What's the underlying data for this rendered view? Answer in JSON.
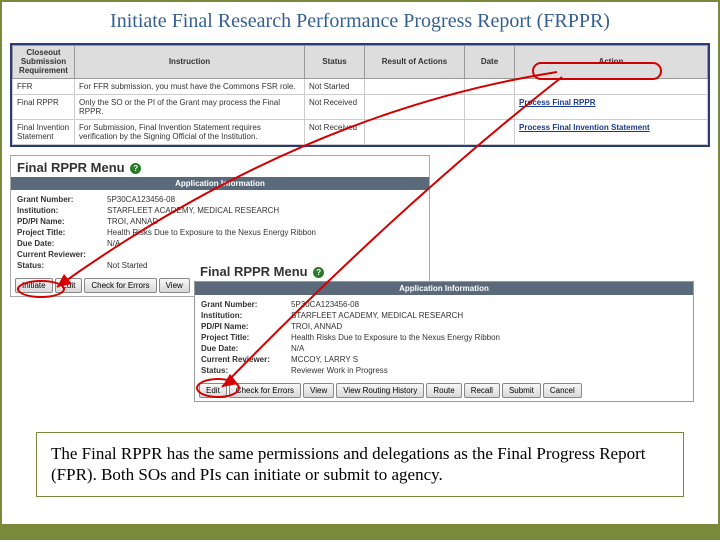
{
  "title": "Initiate Final Research Performance Progress Report (FRPPR)",
  "table": {
    "headers": [
      "Closeout Submission Requirement",
      "Instruction",
      "Status",
      "Result of Actions",
      "Date",
      "Action"
    ],
    "rows": [
      {
        "req": "FFR",
        "inst": "For FFR submission, you must have the Commons FSR role.",
        "status": "Not Started",
        "result": "",
        "date": "",
        "action": ""
      },
      {
        "req": "Final RPPR",
        "inst": "Only the SO or the PI of the Grant may process the Final RPPR.",
        "status": "Not Received",
        "result": "",
        "date": "",
        "action": "Process Final RPPR"
      },
      {
        "req": "Final Invention Statement",
        "inst": "For Submission, Final Invention Statement requires verification by the Signing Official of the Institution.",
        "status": "Not Received",
        "result": "",
        "date": "",
        "action": "Process Final Invention Statement"
      }
    ]
  },
  "panel_title": "Final RPPR Menu",
  "app_info_label": "Application Information",
  "panel1_info": [
    {
      "label": "Grant Number:",
      "value": "5P30CA123456-08"
    },
    {
      "label": "Institution:",
      "value": "STARFLEET ACADEMY, MEDICAL RESEARCH"
    },
    {
      "label": "PD/PI Name:",
      "value": "TROI, ANNAD"
    },
    {
      "label": "Project Title:",
      "value": "Health Risks Due to Exposure to the Nexus Energy Ribbon"
    },
    {
      "label": "Due Date:",
      "value": "N/A"
    },
    {
      "label": "Current Reviewer:",
      "value": ""
    },
    {
      "label": "Status:",
      "value": "Not Started"
    }
  ],
  "panel1_buttons": [
    "Initiate",
    "Edit",
    "Check for Errors",
    "View"
  ],
  "panel2_info": [
    {
      "label": "Grant Number:",
      "value": "5P30CA123456-08"
    },
    {
      "label": "Institution:",
      "value": "STARFLEET ACADEMY, MEDICAL RESEARCH"
    },
    {
      "label": "PD/PI Name:",
      "value": "TROI, ANNAD"
    },
    {
      "label": "Project Title:",
      "value": "Health Risks Due to Exposure to the Nexus Energy Ribbon"
    },
    {
      "label": "Due Date:",
      "value": "N/A"
    },
    {
      "label": "Current Reviewer:",
      "value": "MCCOY, LARRY S"
    },
    {
      "label": "Status:",
      "value": "Reviewer Work in Progress"
    }
  ],
  "panel2_buttons": [
    "Edit",
    "Check for Errors",
    "View",
    "View Routing History",
    "Route",
    "Recall",
    "Submit",
    "Cancel"
  ],
  "callout": "The Final RPPR has the same permissions and delegations as the Final Progress Report (FPR). Both SOs and PIs can initiate or submit to agency."
}
